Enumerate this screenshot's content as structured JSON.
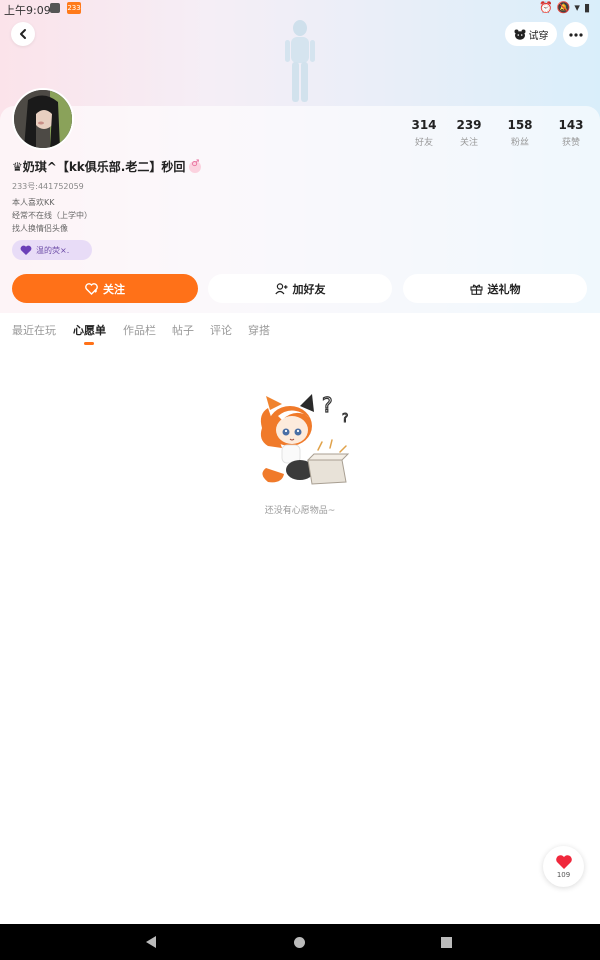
{
  "status_bar": {
    "time": "上午9:09",
    "app_badge": "233"
  },
  "header": {
    "try_label": "试穿"
  },
  "profile": {
    "nickname": "♛奶琪^【kk俱乐部.老二】秒回",
    "uid": "233号:441752059",
    "bio": [
      "本人喜欢KK",
      "经常不在线（上学中）",
      "找人换情侣头像"
    ],
    "tag": "温的荧×.",
    "stats": [
      {
        "value": "314",
        "label": "好友"
      },
      {
        "value": "239",
        "label": "关注"
      },
      {
        "value": "158",
        "label": "粉丝"
      },
      {
        "value": "143",
        "label": "获赞"
      }
    ]
  },
  "actions": {
    "follow": "关注",
    "add_friend": "加好友",
    "gift": "送礼物"
  },
  "tabs": [
    "最近在玩",
    "心愿单",
    "作品栏",
    "帖子",
    "评论",
    "穿搭"
  ],
  "empty_state": {
    "text": "还没有心愿物品~"
  },
  "float_like": {
    "count": "109"
  },
  "colors": {
    "accent": "#ff7118",
    "tag_bg": "#e8dcf7"
  }
}
